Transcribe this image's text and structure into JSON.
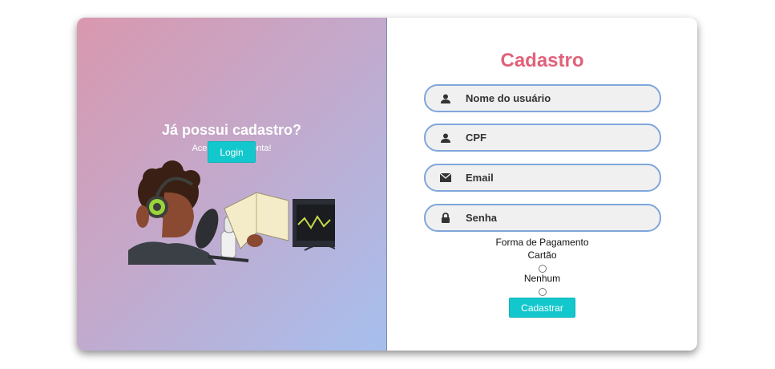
{
  "left": {
    "title": "Já possui cadastro?",
    "subtitle": "Acesse a sua conta!",
    "login_label": "Login",
    "illustration": "podcast-woman-illustration"
  },
  "form": {
    "title": "Cadastro",
    "fields": [
      {
        "placeholder": "Nome do usuário",
        "icon": "user-icon"
      },
      {
        "placeholder": "CPF",
        "icon": "user-icon"
      },
      {
        "placeholder": "Email",
        "icon": "envelope-icon"
      },
      {
        "placeholder": "Senha",
        "icon": "lock-icon"
      }
    ],
    "payment_label": "Forma de Pagamento",
    "options": [
      {
        "label": "Cartão"
      },
      {
        "label": "Nenhum"
      }
    ],
    "submit_label": "Cadastrar"
  },
  "colors": {
    "gradient_start": "#d998ae",
    "gradient_end": "#a6bfee",
    "accent": "#13c8cd",
    "title": "#e0627a",
    "field_border": "#7fa6db"
  }
}
